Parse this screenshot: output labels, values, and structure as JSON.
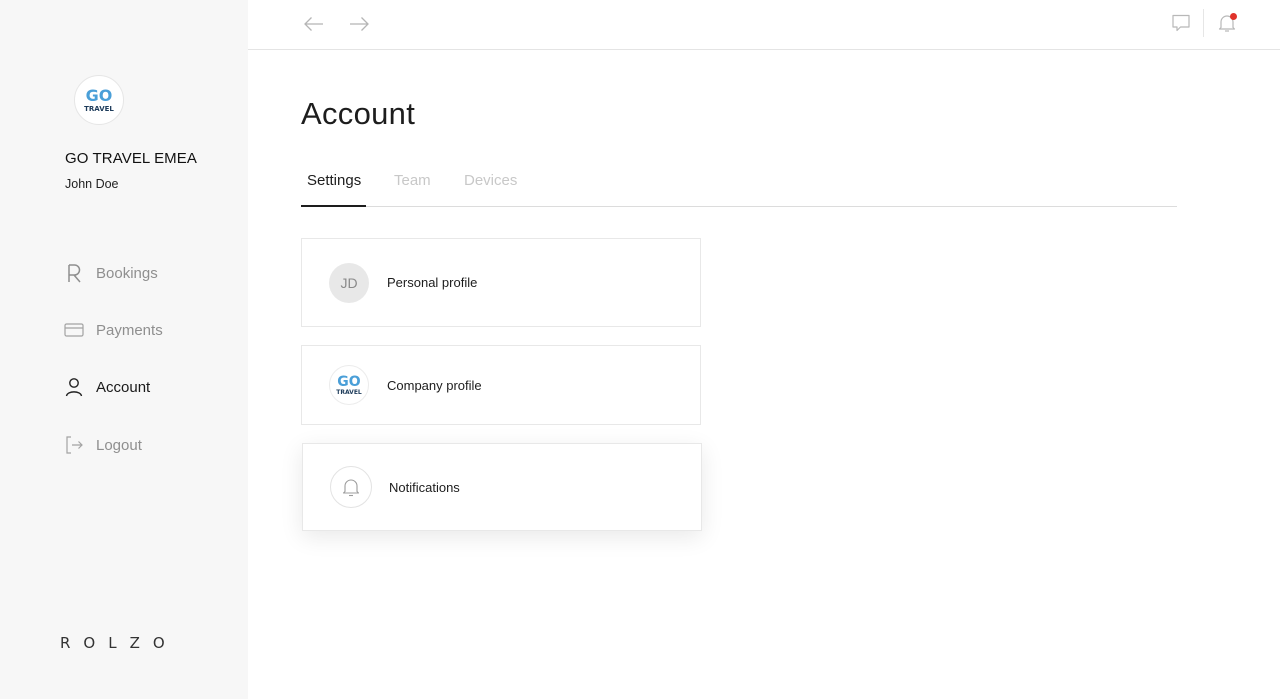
{
  "sidebar": {
    "company_logo": {
      "top_text": "GO",
      "bottom_text": "TRAVEL",
      "color": "#4a9fd8"
    },
    "company_name": "GO TRAVEL EMEA",
    "user_name": "John Doe",
    "nav_items": [
      {
        "label": "Bookings",
        "icon": "bookings-r-icon",
        "active": false
      },
      {
        "label": "Payments",
        "icon": "credit-card-icon",
        "active": false
      },
      {
        "label": "Account",
        "icon": "user-icon",
        "active": true
      },
      {
        "label": "Logout",
        "icon": "logout-icon",
        "active": false
      }
    ],
    "brand": "ROLZO"
  },
  "topbar": {
    "icons": [
      "arrow-left-icon",
      "arrow-right-icon",
      "chat-icon",
      "bell-icon"
    ],
    "notification_dot_color": "#e0332b"
  },
  "main": {
    "title": "Account",
    "tabs": [
      {
        "label": "Settings",
        "active": true
      },
      {
        "label": "Team",
        "active": false
      },
      {
        "label": "Devices",
        "active": false
      }
    ],
    "cards": [
      {
        "label": "Personal profile",
        "avatar_text": "JD"
      },
      {
        "label": "Company profile",
        "avatar": "company-logo"
      },
      {
        "label": "Notifications",
        "avatar": "bell-icon"
      }
    ]
  }
}
